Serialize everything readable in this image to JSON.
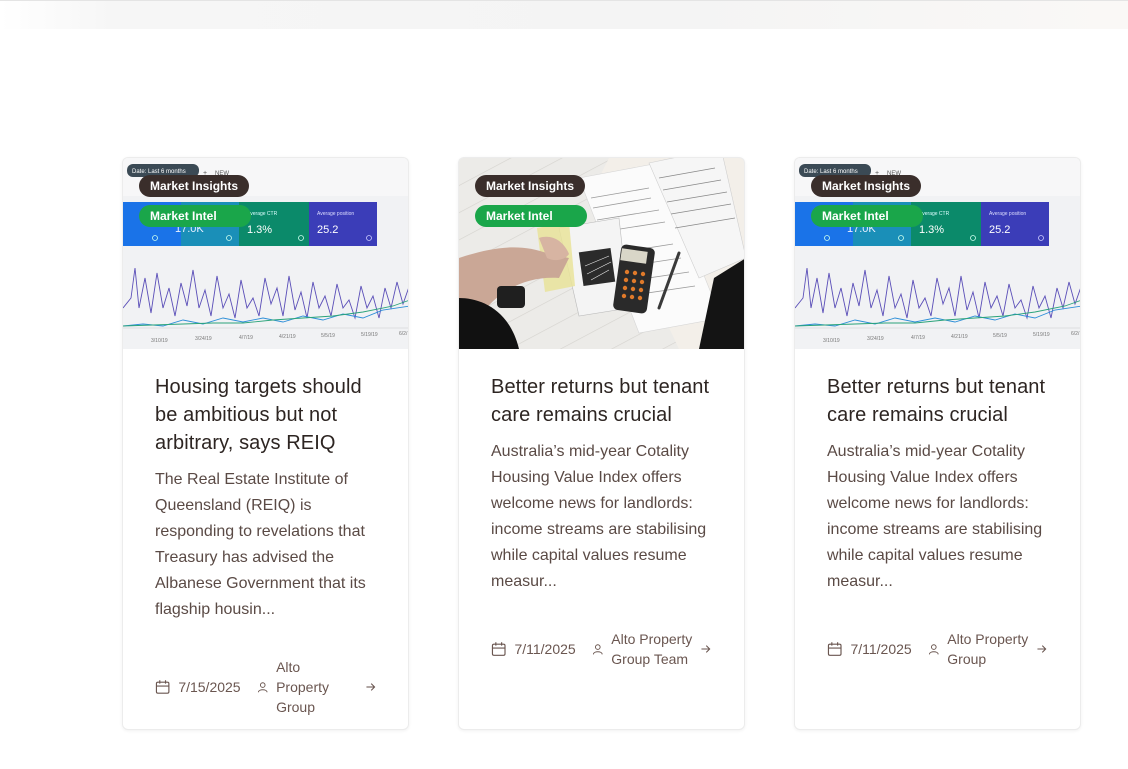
{
  "colors": {
    "category_badge": "#3a2e2b",
    "intel_badge": "#1aa64a",
    "title_text": "#2d2522",
    "body_text": "#5a4a45"
  },
  "articles": [
    {
      "category": "Market Insights",
      "tag": "Market Intel",
      "title": "Housing targets should be ambitious but not arbitrary, says REIQ",
      "excerpt": "The Real Estate Institute of Queensland (REIQ) is responding to revelations that Treasury has advised the Albanese Government that its flagship housin...",
      "date": "7/15/2025",
      "author": "Alto Property Group",
      "image": "analytics-dashboard",
      "image_text": {
        "filter": "Date: Last 6 months",
        "new": "NEW",
        "clicks": "17.0K",
        "ctr_label": "Average CTR",
        "ctr": "1.3%",
        "pos_label": "Average position",
        "pos": "25.2",
        "dates": [
          "3/10/19",
          "3/24/19",
          "4/7/19",
          "4/21/19",
          "5/5/19",
          "5/19/19",
          "6/2/"
        ]
      }
    },
    {
      "category": "Market Insights",
      "tag": "Market Intel",
      "title": "Better returns but tenant care remains crucial",
      "excerpt": "Australia’s mid-year Cotality Housing Value Index offers welcome news for landlords: income streams are stabilising while capital values resume measur...",
      "date": "7/11/2025",
      "author": "Alto Property Group Team",
      "image": "tax-documents-calculator"
    },
    {
      "category": "Market Insights",
      "tag": "Market Intel",
      "title": "Better returns but tenant care remains crucial",
      "excerpt": "Australia’s mid-year Cotality Housing Value Index offers welcome news for landlords: income streams are stabilising while capital values resume measur...",
      "date": "7/11/2025",
      "author": "Alto Property Group",
      "image": "analytics-dashboard",
      "image_text": {
        "filter": "Date: Last 6 months",
        "new": "NEW",
        "clicks": "17.0K",
        "ctr_label": "Average CTR",
        "ctr": "1.3%",
        "pos_label": "Average position",
        "pos": "25.2",
        "dates": [
          "3/10/19",
          "3/24/19",
          "4/7/19",
          "4/21/19",
          "5/5/19",
          "5/19/19",
          "6/2/"
        ]
      }
    }
  ]
}
